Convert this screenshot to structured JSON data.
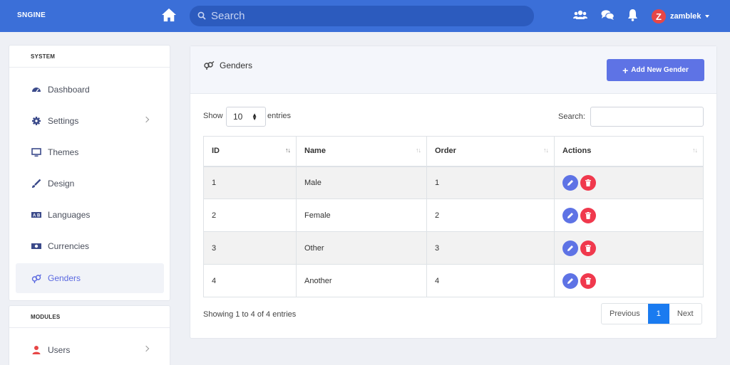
{
  "brand": "SNGINE",
  "search": {
    "placeholder": "Search"
  },
  "user": {
    "initial": "Z",
    "name": "zamblek"
  },
  "sidebar": {
    "system_header": "SYSTEM",
    "modules_header": "MODULES",
    "items": [
      {
        "label": "Dashboard",
        "icon": "dashboard-icon"
      },
      {
        "label": "Settings",
        "icon": "gear-icon"
      },
      {
        "label": "Themes",
        "icon": "monitor-icon"
      },
      {
        "label": "Design",
        "icon": "paintbrush-icon"
      },
      {
        "label": "Languages",
        "icon": "language-icon"
      },
      {
        "label": "Currencies",
        "icon": "money-icon"
      },
      {
        "label": "Genders",
        "icon": "genderless-icon"
      }
    ],
    "module_items": [
      {
        "label": "Users",
        "icon": "user-icon"
      }
    ]
  },
  "main": {
    "title": "Genders",
    "add_button": "Add New Gender",
    "show_label": "Show",
    "page_length": "10",
    "entries_label": "entries",
    "search_label": "Search:",
    "columns": [
      "ID",
      "Name",
      "Order",
      "Actions"
    ],
    "rows": [
      {
        "id": "1",
        "name": "Male",
        "order": "1"
      },
      {
        "id": "2",
        "name": "Female",
        "order": "2"
      },
      {
        "id": "3",
        "name": "Other",
        "order": "3"
      },
      {
        "id": "4",
        "name": "Another",
        "order": "4"
      }
    ],
    "info": "Showing 1 to 4 of 4 entries",
    "pagination": {
      "previous": "Previous",
      "current": "1",
      "next": "Next"
    }
  },
  "colors": {
    "navbar": "#3b6fd8",
    "accent": "#5e73e5",
    "danger": "#f0394d",
    "active_page": "#1a7bf0"
  }
}
